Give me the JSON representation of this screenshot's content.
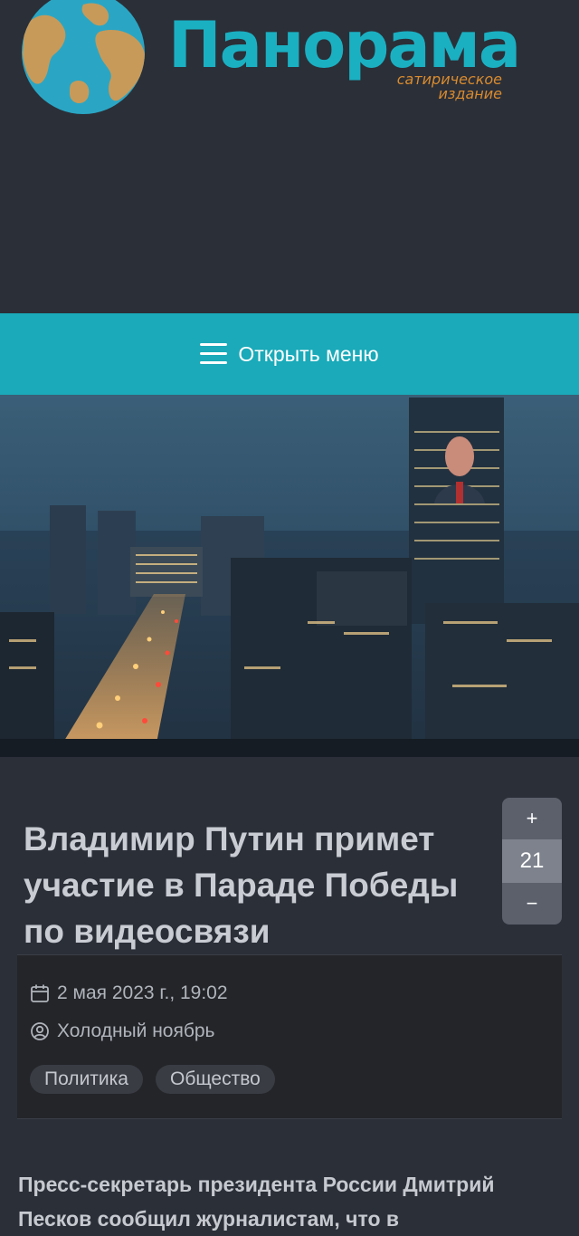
{
  "site": {
    "name": "Панорама",
    "tagline_line1": "сатирическое",
    "tagline_line2": "издание",
    "logo_icon": "globe-icon"
  },
  "menu": {
    "label": "Открыть меню",
    "icon": "hamburger-icon"
  },
  "article": {
    "title": "Владимир Путин примет участие в Параде Победы по видеосвязи",
    "date": "2 мая 2023 г., 19:02",
    "author": "Холодный ноябрь",
    "tags": [
      "Политика",
      "Общество"
    ],
    "lead": "Пресс-секретарь президента России Дмитрий Песков сообщил журналистам, что в"
  },
  "votes": {
    "plus_label": "+",
    "count": "21",
    "minus_label": "−"
  },
  "colors": {
    "accent": "#1aaab9",
    "background": "#2b2f38",
    "tagline": "#d98b2e"
  }
}
